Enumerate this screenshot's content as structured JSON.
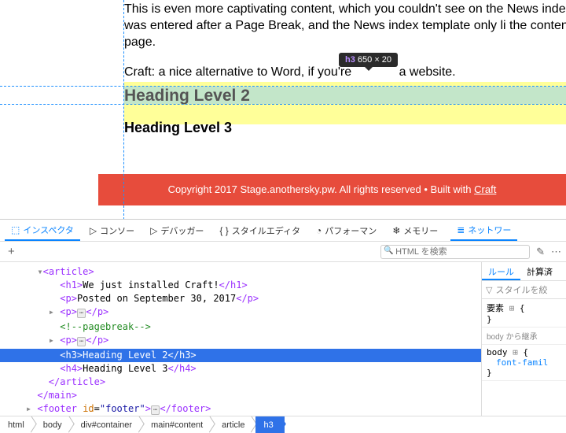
{
  "page": {
    "para1": "This is even more captivating content, which you couldn't see on the News inde because it was entered after a Page Break, and the News index template only li the content on the first page.",
    "para2_a": "Craft: a nice alternative to Word, if you're ",
    "para2_b": " a website.",
    "h3": "Heading Level 2",
    "h4": "Heading Level 3"
  },
  "tooltip": {
    "tag": "h3",
    "dims": "650 × 20"
  },
  "footer": {
    "copyright": "Copyright 2017 Stage.anothersky.pw. All rights reserved ",
    "sep": " •  Built with ",
    "link": "Craft"
  },
  "devtools": {
    "tabs": {
      "inspector": "インスペクタ",
      "console": "コンソー",
      "debugger": "デバッガー",
      "style": "スタイルエディタ",
      "perf": "パフォーマン",
      "memory": "メモリー",
      "network": "ネットワー"
    },
    "search_placeholder": "HTML を検索",
    "dom": {
      "article_open": "article",
      "h1_text": "We just installed Craft!",
      "p_posted": "Posted on September 30, 2017",
      "pagebreak": "<!--pagebreak-->",
      "h3_text": "Heading Level 2",
      "h4_text": "Heading Level 3",
      "footer_id": "footer"
    },
    "styles": {
      "tabs": {
        "rules": "ルール",
        "computed": "計算済"
      },
      "filter": "スタイルを絞",
      "element_sel": "要素",
      "inherit": "body から継承",
      "body_sel": "body",
      "prop": "font-famil"
    },
    "breadcrumb": [
      "html",
      "body",
      "div#container",
      "main#content",
      "article",
      "h3"
    ]
  }
}
